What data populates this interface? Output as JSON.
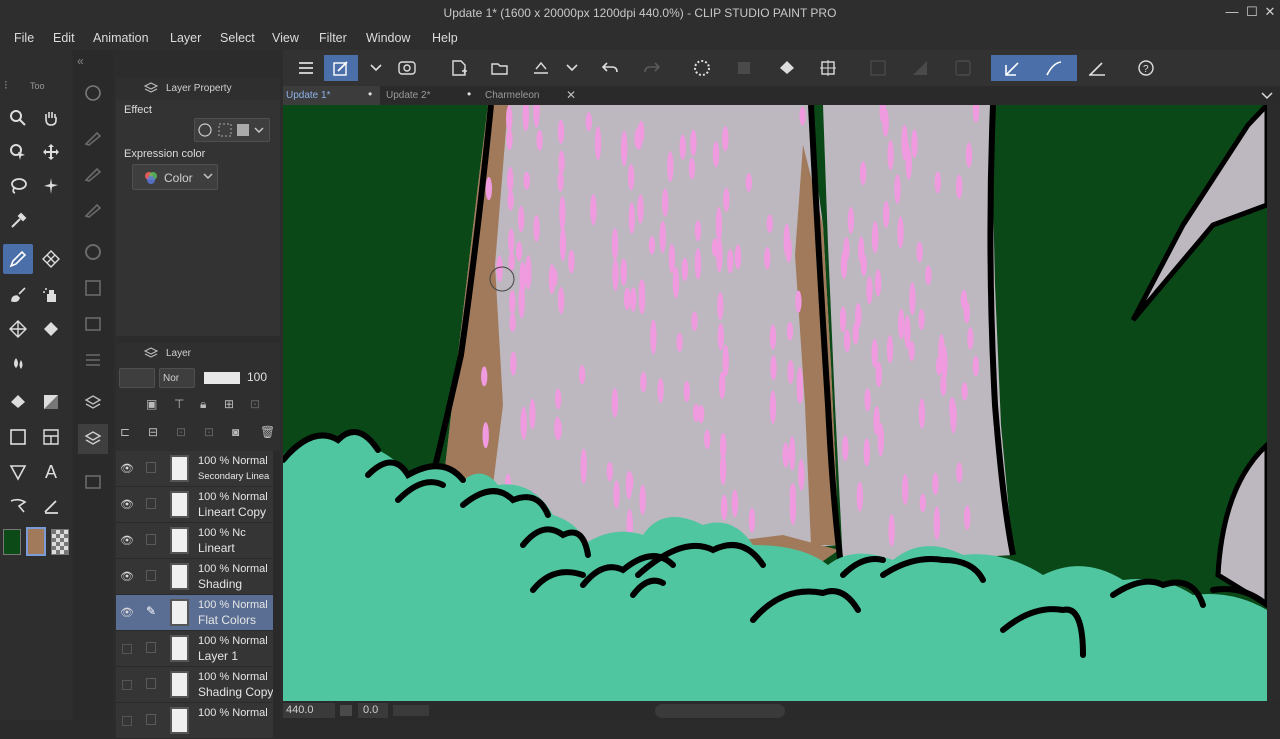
{
  "window": {
    "title": "Update 1* (1600 x 20000px 1200dpi 440.0%)  - CLIP STUDIO PAINT PRO",
    "minimize": "—",
    "maximize": "☐",
    "close": "✕"
  },
  "menu": [
    "File",
    "Edit",
    "Animation",
    "Layer",
    "Select",
    "View",
    "Filter",
    "Window",
    "Help"
  ],
  "tabs": [
    {
      "label": "Update 1*",
      "active": true
    },
    {
      "label": "Update 2*",
      "active": false
    },
    {
      "label": "Charmeleon",
      "active": false
    }
  ],
  "tool_panel": {
    "header": "Too"
  },
  "layer_property": {
    "title": "Layer Property",
    "effect_label": "Effect",
    "expression_label": "Expression color",
    "expression_value": "Color"
  },
  "layer_panel": {
    "title": "Layer",
    "blend_mode": "Nor",
    "opacity": "100",
    "layers": [
      {
        "mode": "100 % Normal",
        "name": "Secondary Linea",
        "visible": true,
        "selected": false,
        "small": true
      },
      {
        "mode": "100 % Normal",
        "name": "Lineart Copy",
        "visible": true,
        "selected": false,
        "small": false
      },
      {
        "mode": "100 % Nc",
        "name": "Lineart",
        "visible": true,
        "selected": false,
        "small": false
      },
      {
        "mode": "100 % Normal",
        "name": "Shading",
        "visible": true,
        "selected": false,
        "small": false
      },
      {
        "mode": "100 % Normal",
        "name": "Flat Colors",
        "visible": true,
        "selected": true,
        "small": false
      },
      {
        "mode": "100 % Normal",
        "name": "Layer 1",
        "visible": false,
        "selected": false,
        "small": false
      },
      {
        "mode": "100 % Normal",
        "name": "Shading Copy",
        "visible": false,
        "selected": false,
        "small": false
      },
      {
        "mode": "100 % Normal",
        "name": "",
        "visible": false,
        "selected": false,
        "small": false
      }
    ]
  },
  "colors": {
    "main": "#0c4a18",
    "sub": "#a07a5a",
    "accent": "#4b6fa8",
    "bush": "#4fc6a0",
    "trunk": "#bdb7bf",
    "bark": "#a07a5a",
    "fur": "#f09ae0"
  },
  "status": {
    "zoom": "440.0",
    "angle": "0.0"
  }
}
